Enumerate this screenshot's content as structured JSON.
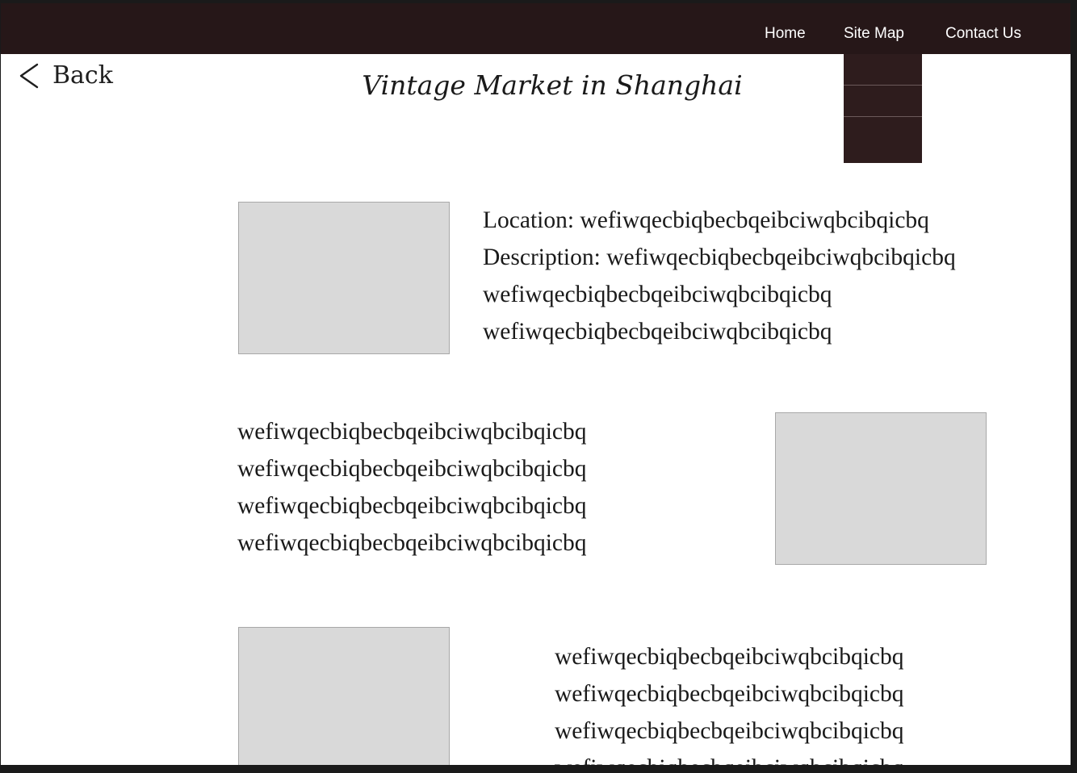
{
  "nav": {
    "links": [
      "Home",
      "Site Map",
      "Contact Us"
    ]
  },
  "back": {
    "label": "Back"
  },
  "page_title": "Vintage Market in Shanghai",
  "sections": [
    {
      "lines": [
        "Location: wefiwqecbiqbecbqeibciwqbcibqicbq",
        "Description: wefiwqecbiqbecbqeibciwqbcibqicbq",
        "wefiwqecbiqbecbqeibciwqbcibqicbq",
        "wefiwqecbiqbecbqeibciwqbcibqicbq"
      ]
    },
    {
      "lines": [
        "wefiwqecbiqbecbqeibciwqbcibqicbq",
        "wefiwqecbiqbecbqeibciwqbcibqicbq",
        "wefiwqecbiqbecbqeibciwqbcibqicbq",
        "wefiwqecbiqbecbqeibciwqbcibqicbq"
      ]
    },
    {
      "lines": [
        "wefiwqecbiqbecbqeibciwqbcibqicbq",
        "wefiwqecbiqbecbqeibciwqbcibqicbq",
        "wefiwqecbiqbecbqeibciwqbcibqicbq",
        "wefiwqecbiqbecbqeibciwqbcibqicbq"
      ]
    }
  ],
  "icons": {
    "back": "chevron-left-icon"
  },
  "colors": {
    "navbar": "#261718",
    "dropdown": "#2e1c1d",
    "image_placeholder": "#d9d9d9",
    "text": "#1a1a1a"
  }
}
